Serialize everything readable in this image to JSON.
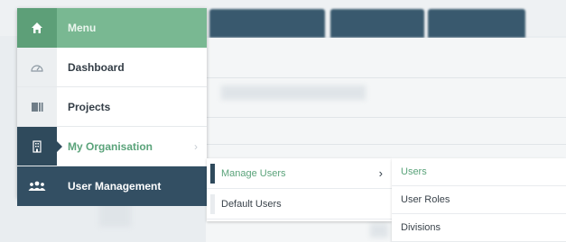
{
  "menu": {
    "header": {
      "label": "Menu",
      "icon": "home-icon"
    },
    "items": [
      {
        "label": "Dashboard",
        "icon": "gauge-icon"
      },
      {
        "label": "Projects",
        "icon": "book-icon"
      },
      {
        "label": "My Organisation",
        "icon": "building-icon",
        "state": "active"
      },
      {
        "label": "User Management",
        "icon": "users-icon",
        "state": "selected"
      }
    ]
  },
  "submenu": {
    "items": [
      {
        "label": "Manage Users",
        "active": true
      },
      {
        "label": "Default Users",
        "active": false
      }
    ]
  },
  "submenu2": {
    "items": [
      {
        "label": "Users",
        "active": true
      },
      {
        "label": "User Roles",
        "active": false
      },
      {
        "label": "Divisions",
        "active": false
      }
    ]
  },
  "colors": {
    "header_green": "#79b892",
    "accent_green": "#5aa37a",
    "dark_slate": "#334f63"
  }
}
